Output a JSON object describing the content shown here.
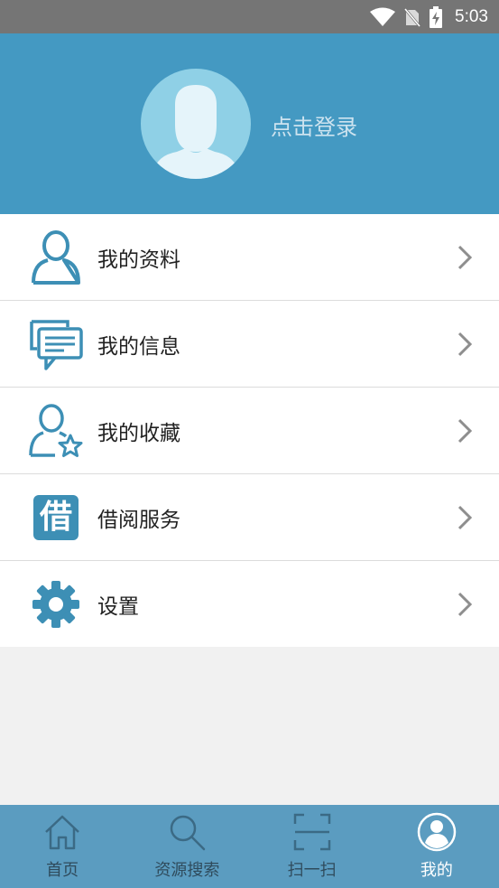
{
  "status_bar": {
    "time": "5:03",
    "icons": [
      "wifi-icon",
      "no-sim-icon",
      "battery-charging-icon"
    ]
  },
  "header": {
    "login_text": "点击登录",
    "avatar_icon": "avatar-placeholder-icon"
  },
  "menu": {
    "items": [
      {
        "label": "我的资料",
        "icon": "user-outline-icon"
      },
      {
        "label": "我的信息",
        "icon": "chat-bubbles-icon"
      },
      {
        "label": "我的收藏",
        "icon": "user-star-icon"
      },
      {
        "label": "借阅服务",
        "icon": "borrow-char-icon",
        "icon_char": "借"
      },
      {
        "label": "设置",
        "icon": "gear-icon"
      }
    ]
  },
  "tabbar": {
    "tabs": [
      {
        "label": "首页",
        "icon": "home-icon",
        "active": false
      },
      {
        "label": "资源搜索",
        "icon": "search-icon",
        "active": false
      },
      {
        "label": "扫一扫",
        "icon": "scan-icon",
        "active": false
      },
      {
        "label": "我的",
        "icon": "profile-icon",
        "active": true
      }
    ]
  },
  "colors": {
    "header_bg": "#4499c2",
    "icon_blue": "#3d8fb5",
    "tabbar_bg": "#5b9cc0",
    "status_bar_bg": "#757575"
  }
}
